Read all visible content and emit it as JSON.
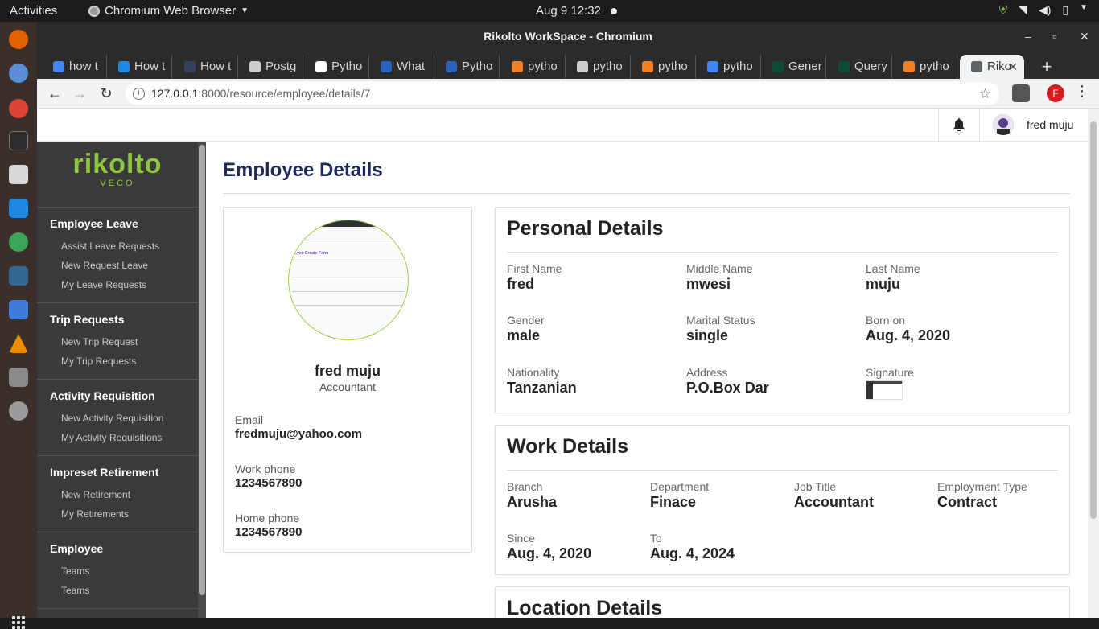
{
  "os": {
    "activities": "Activities",
    "app_name": "Chromium Web Browser",
    "clock": "Aug 9  12:32"
  },
  "window": {
    "title": "Rikolto WorkSpace - Chromium"
  },
  "tabs": [
    {
      "label": "how t",
      "color": "#4285f4"
    },
    {
      "label": "How t",
      "color": "#1e88e5"
    },
    {
      "label": "How t",
      "color": "#33415c"
    },
    {
      "label": "Postg",
      "color": "#cccccc"
    },
    {
      "label": "Pytho",
      "color": "#ffffff"
    },
    {
      "label": "What",
      "color": "#2a62bc"
    },
    {
      "label": "Pytho",
      "color": "#2a62bc"
    },
    {
      "label": "pytho",
      "color": "#f48024"
    },
    {
      "label": "pytho",
      "color": "#cccccc"
    },
    {
      "label": "pytho",
      "color": "#f48024"
    },
    {
      "label": "pytho",
      "color": "#4285f4"
    },
    {
      "label": "Gener",
      "color": "#0c4b33"
    },
    {
      "label": "Query",
      "color": "#0c4b33"
    },
    {
      "label": "pytho",
      "color": "#f48024"
    },
    {
      "label": "Riko",
      "color": "#5f6368"
    }
  ],
  "address": {
    "host": "127.0.0.1",
    "path": ":8000/resource/employee/details/7"
  },
  "profile_initial": "F",
  "header": {
    "user_name": "fred muju"
  },
  "sidebar": {
    "brand": "rikolto",
    "brand_sub": "VECO",
    "sections": [
      {
        "title": "Employee Leave",
        "items": [
          "Assist Leave Requests",
          "New Request Leave",
          "My Leave Requests"
        ]
      },
      {
        "title": "Trip Requests",
        "items": [
          "New Trip Request",
          "My Trip Requests"
        ]
      },
      {
        "title": "Activity Requisition",
        "items": [
          "New Activity Requisition",
          "My Activity Requisitions"
        ]
      },
      {
        "title": "Impreset Retirement",
        "items": [
          "New Retirement",
          "My Retirements"
        ]
      },
      {
        "title": "Employee",
        "items": [
          "Teams",
          "Teams"
        ]
      }
    ]
  },
  "page_title": "Employee Details",
  "profile": {
    "name": "fred muju",
    "role": "Accountant",
    "photo_text": "...yee Create Form",
    "email_label": "Email",
    "email": "fredmuju@yahoo.com",
    "work_phone_label": "Work phone",
    "work_phone": "1234567890",
    "home_phone_label": "Home phone",
    "home_phone": "1234567890"
  },
  "personal": {
    "title": "Personal Details",
    "fields": [
      {
        "label": "First Name",
        "value": "fred"
      },
      {
        "label": "Middle Name",
        "value": "mwesi"
      },
      {
        "label": "Last Name",
        "value": "muju"
      },
      {
        "label": "Gender",
        "value": "male"
      },
      {
        "label": "Marital Status",
        "value": "single"
      },
      {
        "label": "Born on",
        "value": "Aug. 4, 2020"
      },
      {
        "label": "Nationality",
        "value": "Tanzanian"
      },
      {
        "label": "Address",
        "value": "P.O.Box Dar"
      },
      {
        "label": "Signature",
        "value": ""
      }
    ]
  },
  "work": {
    "title": "Work Details",
    "fields": [
      {
        "label": "Branch",
        "value": "Arusha"
      },
      {
        "label": "Department",
        "value": "Finace"
      },
      {
        "label": "Job Title",
        "value": "Accountant"
      },
      {
        "label": "Employment Type",
        "value": "Contract"
      },
      {
        "label": "Since",
        "value": "Aug. 4, 2020"
      },
      {
        "label": "To",
        "value": "Aug. 4, 2024"
      }
    ]
  },
  "location": {
    "title": "Location Details"
  },
  "colors": {
    "brand_green": "#8dc63f",
    "title_navy": "#1e2a5a",
    "sidebar_bg": "#3b3a3a"
  }
}
